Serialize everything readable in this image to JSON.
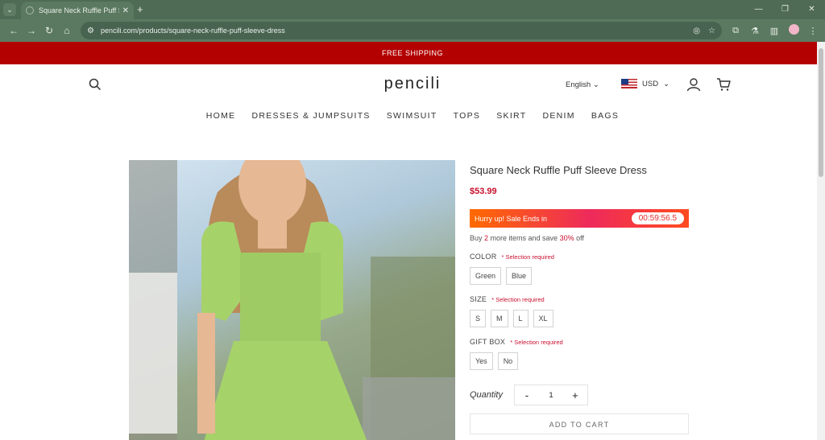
{
  "browser": {
    "tab_title": "Square Neck Ruffle Puff Sleeve",
    "new_tab_label": "+",
    "url": "pencili.com/products/square-neck-ruffle-puff-sleeve-dress"
  },
  "announcement": "FREE SHIPPING",
  "header": {
    "logo": "pencili",
    "language": "English",
    "currency": "USD"
  },
  "nav": [
    "HOME",
    "DRESSES & JUMPSUITS",
    "SWIMSUIT",
    "TOPS",
    "SKIRT",
    "DENIM",
    "BAGS"
  ],
  "product": {
    "title": "Square Neck Ruffle Puff Sleeve Dress",
    "price": "$53.99",
    "sale_text": "Hurry up! Sale Ends in",
    "countdown": "00:59:56.5",
    "bundle_prefix": "Buy ",
    "bundle_count": "2",
    "bundle_middle": " more items and save ",
    "bundle_pct": "30%",
    "bundle_suffix": " off",
    "color_label": "COLOR",
    "size_label": "SIZE",
    "gift_label": "GIFT BOX",
    "required_text": "* Selection required",
    "colors": [
      "Green",
      "Blue"
    ],
    "sizes": [
      "S",
      "M",
      "L",
      "XL"
    ],
    "gift_options": [
      "Yes",
      "No"
    ],
    "quantity_label": "Quantity",
    "quantity": "1",
    "minus": "-",
    "plus": "+",
    "add_to_cart": "ADD TO CART"
  },
  "colors": {
    "tabbar": "#4f6b55",
    "toolbar": "#5b7960",
    "announce_bg": "#b30000",
    "price": "#c8102e",
    "dress": "#a6d26a"
  }
}
